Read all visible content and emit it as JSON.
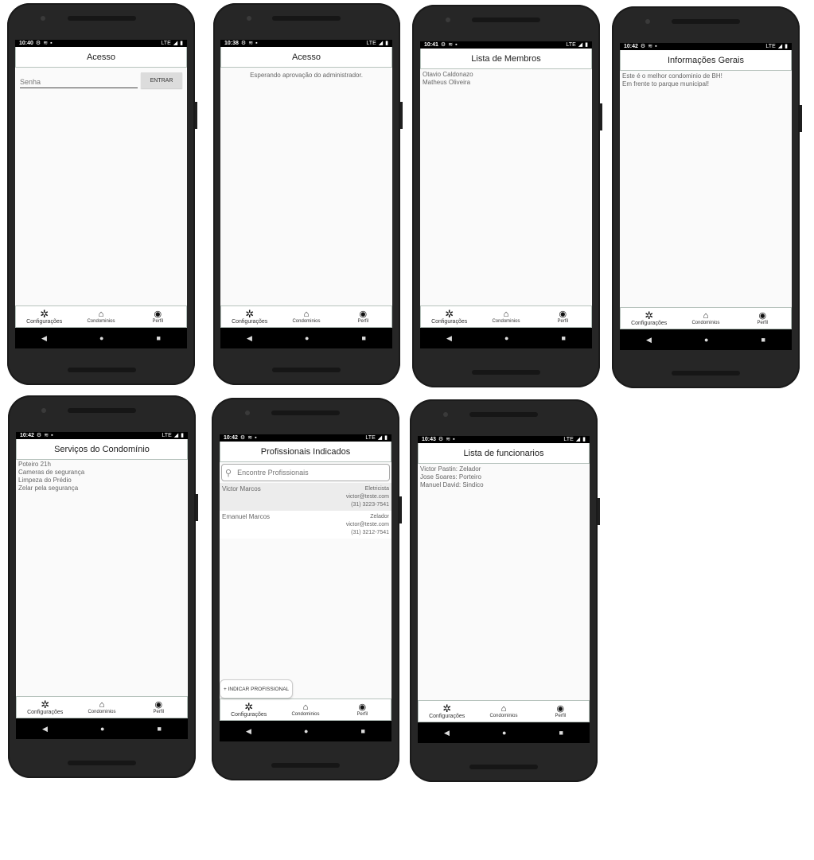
{
  "nav": {
    "settings": "Configurações",
    "condos": "Condominios",
    "profile": "Perfil"
  },
  "screens": {
    "access_login": {
      "time": "10:40",
      "title": "Acesso",
      "password_placeholder": "Senha",
      "enter_label": "ENTRAR"
    },
    "access_wait": {
      "time": "10:38",
      "title": "Acesso",
      "message": "Esperando aprovação do administrador."
    },
    "members": {
      "time": "10:41",
      "title": "Lista de Membros",
      "items": [
        "Otavio Caldonazo",
        "Matheus Oliveira"
      ]
    },
    "info": {
      "time": "10:42",
      "title": "Informações Gerais",
      "lines": [
        "Este é o melhor condominio de BH!",
        "Em frente to parque municipal!"
      ]
    },
    "services": {
      "time": "10:42",
      "title": "Serviços do Condomínio",
      "items": [
        "Poteiro 21h",
        "Cameras de segurança",
        "Limpeza do Prédio",
        "Zelar pela segurança"
      ]
    },
    "professionals": {
      "time": "10:42",
      "title": "Profissionais Indicados",
      "search_placeholder": "Encontre Profissionais",
      "items": [
        {
          "name": "Victor Marcos",
          "role": "Eletricista",
          "email": "victor@teste.com",
          "phone": "(31) 3223-7541"
        },
        {
          "name": "Emanuel Marcos",
          "role": "Zelador",
          "email": "victor@teste.com",
          "phone": "(31) 3212-7541"
        }
      ],
      "add_label": "+ INDICAR PROFISSIONAL"
    },
    "staff": {
      "time": "10:43",
      "title": "Lista de funcionarios",
      "items": [
        "Victor Pastin: Zelador",
        "Jose Soares: Porteiro",
        "Manuel David: Sindico"
      ]
    }
  },
  "statusbar": {
    "network": "LTE"
  },
  "colors": {
    "border": "#b7c3bd",
    "screen_bg": "#fafafa",
    "phone_body": "#262626"
  }
}
